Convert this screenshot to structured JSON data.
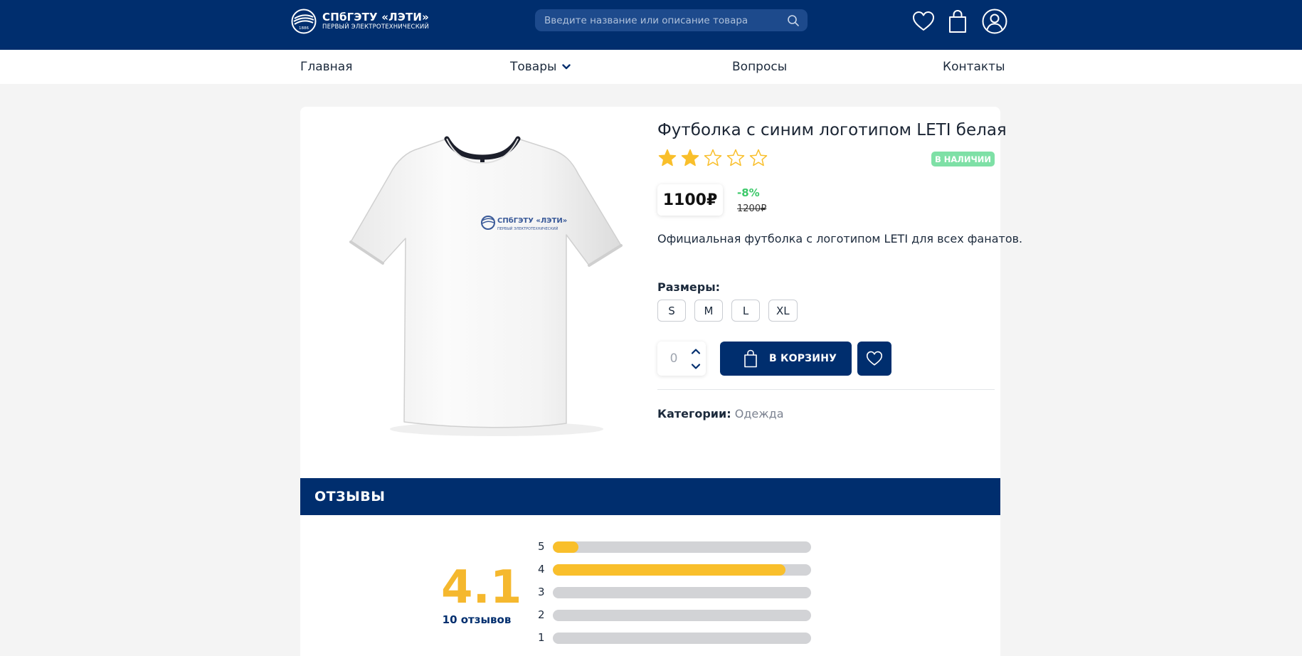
{
  "header": {
    "logo_title": "СПбГЭТУ «ЛЭТИ»",
    "logo_subtitle": "ПЕРВЫЙ ЭЛЕКТРОТЕХНИЧЕСКИЙ",
    "logo_year": "1886",
    "search_placeholder": "Введите название или описание товара",
    "icons": [
      "heart-icon",
      "shopping-bag-icon",
      "user-icon"
    ]
  },
  "nav": {
    "items": [
      {
        "label": "Главная"
      },
      {
        "label": "Товары",
        "has_dropdown": true
      },
      {
        "label": "Вопросы"
      },
      {
        "label": "Контакты"
      }
    ]
  },
  "product": {
    "title": "Футболка с синим логотипом LETI белая",
    "rating_stars": 2,
    "rating_max": 5,
    "stock_badge": "В НАЛИЧИИ",
    "price": "1100₽",
    "discount": "-8%",
    "old_price": "1200₽",
    "description": "Официальная футболка с логотипом LETI для всех фанатов.",
    "sizes_label": "Размеры:",
    "sizes": [
      "S",
      "M",
      "L",
      "XL"
    ],
    "quantity": "0",
    "cart_button": "В КОРЗИНУ",
    "categories_label": "Категории:",
    "categories_value": "Одежда",
    "shirt_logo_title": "СПбГЭТУ «ЛЭТИ»",
    "shirt_logo_subtitle": "ПЕРВЫЙ ЭЛЕКТРОТЕХНИЧЕСКИЙ"
  },
  "reviews": {
    "title": "ОТЗЫВЫ",
    "average": "4.1",
    "count_label": "10 отзывов",
    "distribution": [
      {
        "stars": "5",
        "fraction": 0.1
      },
      {
        "stars": "4",
        "fraction": 0.9
      },
      {
        "stars": "3",
        "fraction": 0
      },
      {
        "stars": "2",
        "fraction": 0
      },
      {
        "stars": "1",
        "fraction": 0
      }
    ]
  },
  "colors": {
    "brand": "#002e6e",
    "accent_star": "#f9bf2b",
    "success": "#3cc96a",
    "stock_badge": "#7ee0a6"
  }
}
